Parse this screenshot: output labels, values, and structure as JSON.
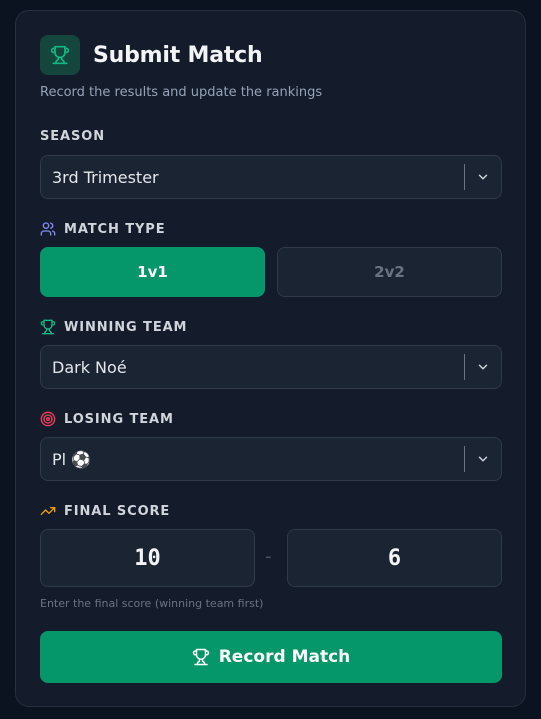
{
  "header": {
    "icon": "trophy-icon",
    "title": "Submit Match",
    "subtitle": "Record the results and update the rankings"
  },
  "season": {
    "label": "SEASON",
    "value": "3rd Trimester"
  },
  "match_type": {
    "label": "MATCH TYPE",
    "icon": "users-icon",
    "options": [
      "1v1",
      "2v2"
    ],
    "selected": "1v1"
  },
  "winning_team": {
    "label": "WINNING TEAM",
    "icon": "trophy-icon",
    "value": "Dark Noé"
  },
  "losing_team": {
    "label": "LOSING TEAM",
    "icon": "target-icon",
    "value": "Pl ⚽"
  },
  "final_score": {
    "label": "FINAL SCORE",
    "icon": "trending-up-icon",
    "winner_score": "10",
    "separator": "-",
    "loser_score": "6",
    "hint": "Enter the final score (winning team first)"
  },
  "submit": {
    "label": "Record Match",
    "icon": "trophy-icon"
  },
  "colors": {
    "accent": "#059669",
    "background": "#0b1220",
    "card": "#141c2b",
    "input": "#1b2433"
  }
}
